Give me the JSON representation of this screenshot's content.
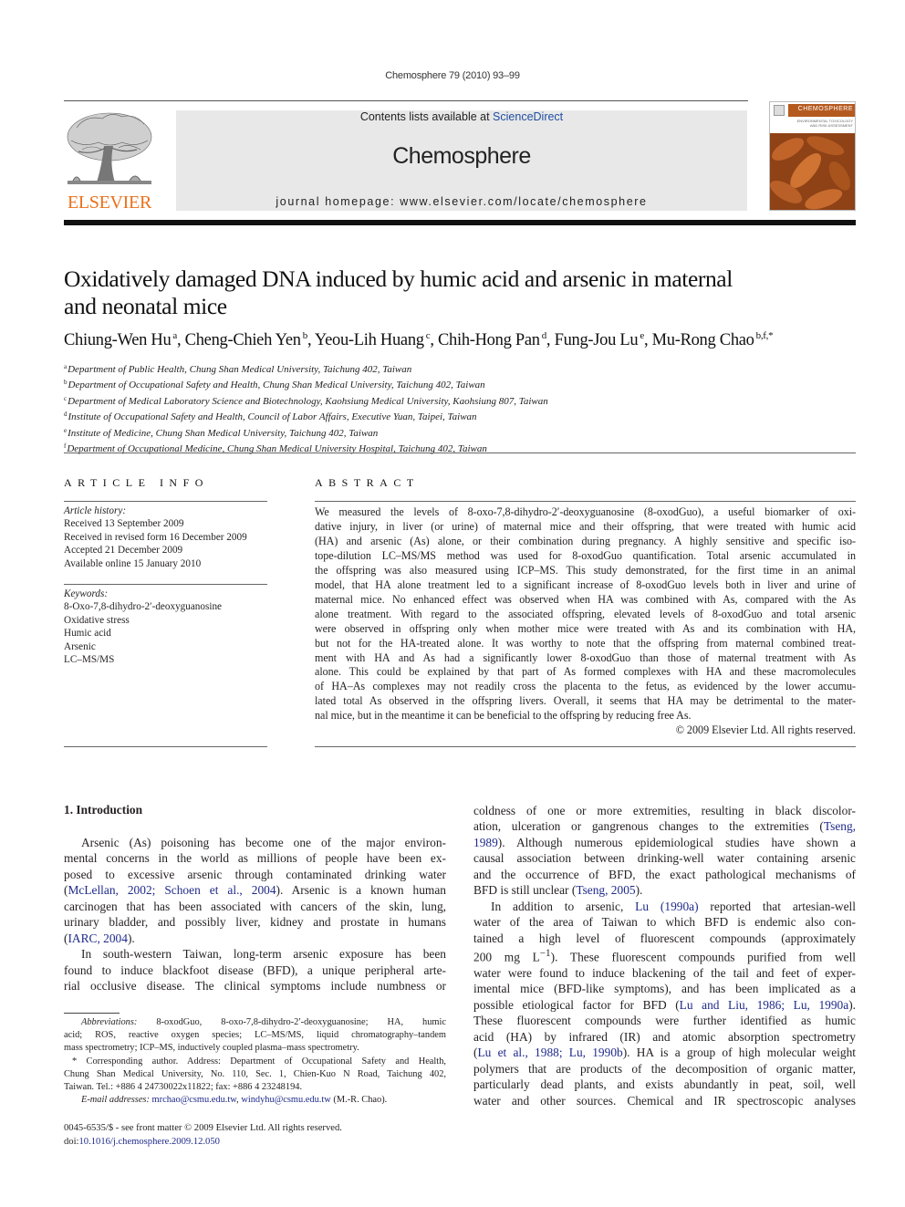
{
  "header": {
    "running_head": "Chemosphere 79 (2010) 93–99",
    "contents_prefix": "Contents lists available at ",
    "contents_link": "ScienceDirect",
    "journal_name": "Chemosphere",
    "homepage": "journal homepage: www.elsevier.com/locate/chemosphere",
    "publisher_logo_text": "ELSEVIER",
    "cover_title": "CHEMOSPHERE",
    "cover_subtitle": "ENVIRONMENTAL TOXICOLOGY AND RISK ASSESSMENT"
  },
  "colors": {
    "link": "#1f2a8a",
    "elsevier_orange": "#e9711c",
    "masthead_bg": "#e8e8e8",
    "cover_orange": "#a5501b"
  },
  "article": {
    "title_line1": "Oxidatively damaged DNA induced by humic acid and arsenic in maternal",
    "title_line2": "and neonatal mice",
    "authors": [
      {
        "name": "Chiung-Wen Hu",
        "sup": "a"
      },
      {
        "name": "Cheng-Chieh Yen",
        "sup": "b"
      },
      {
        "name": "Yeou-Lih Huang",
        "sup": "c"
      },
      {
        "name": "Chih-Hong Pan",
        "sup": "d"
      },
      {
        "name": "Fung-Jou Lu",
        "sup": "e"
      },
      {
        "name": "Mu-Rong Chao",
        "sup": "b,f,*"
      }
    ],
    "affiliations": [
      {
        "sup": "a",
        "text": "Department of Public Health, Chung Shan Medical University, Taichung 402, Taiwan"
      },
      {
        "sup": "b",
        "text": "Department of Occupational Safety and Health, Chung Shan Medical University, Taichung 402, Taiwan"
      },
      {
        "sup": "c",
        "text": "Department of Medical Laboratory Science and Biotechnology, Kaohsiung Medical University, Kaohsiung 807, Taiwan"
      },
      {
        "sup": "d",
        "text": "Institute of Occupational Safety and Health, Council of Labor Affairs, Executive Yuan, Taipei, Taiwan"
      },
      {
        "sup": "e",
        "text": "Institute of Medicine, Chung Shan Medical University, Taichung 402, Taiwan"
      },
      {
        "sup": "f",
        "text": "Department of Occupational Medicine, Chung Shan Medical University Hospital, Taichung 402, Taiwan"
      }
    ]
  },
  "article_info": {
    "heading": "ARTICLE INFO",
    "history_label": "Article history:",
    "history": [
      "Received 13 September 2009",
      "Received in revised form 16 December 2009",
      "Accepted 21 December 2009",
      "Available online 15 January 2010"
    ],
    "keywords_label": "Keywords:",
    "keywords": [
      "8-Oxo-7,8-dihydro-2′-deoxyguanosine",
      "Oxidative stress",
      "Humic acid",
      "Arsenic",
      "LC–MS/MS"
    ]
  },
  "abstract": {
    "heading": "ABSTRACT",
    "lines": [
      "We measured the levels of 8-oxo-7,8-dihydro-2′-deoxyguanosine (8-oxodGuo), a useful biomarker of oxi-",
      "dative injury, in liver (or urine) of maternal mice and their offspring, that were treated with humic acid",
      "(HA) and arsenic (As) alone, or their combination during pregnancy. A highly sensitive and specific iso-",
      "tope-dilution LC–MS/MS method was used for 8-oxodGuo quantification. Total arsenic accumulated in",
      "the offspring was also measured using ICP–MS. This study demonstrated, for the first time in an animal",
      "model, that HA alone treatment led to a significant increase of 8-oxodGuo levels both in liver and urine of",
      "maternal mice. No enhanced effect was observed when HA was combined with As, compared with the As",
      "alone treatment. With regard to the associated offspring, elevated levels of 8-oxodGuo and total arsenic",
      "were observed in offspring only when mother mice were treated with As and its combination with HA,",
      "but not for the HA-treated alone. It was worthy to note that the offspring from maternal combined treat-",
      "ment with HA and As had a significantly lower 8-oxodGuo than those of maternal treatment with As",
      "alone. This could be explained by that part of As formed complexes with HA and these macromolecules",
      "of HA–As complexes may not readily cross the placenta to the fetus, as evidenced by the lower accumu-",
      "lated total As observed in the offspring livers. Overall, it seems that HA may be detrimental to the mater-",
      "nal mice, but in the meantime it can be beneficial to the offspring by reducing free As."
    ],
    "copyright": "© 2009 Elsevier Ltd. All rights reserved."
  },
  "introduction": {
    "heading": "1. Introduction",
    "left_lines": [
      {
        "indent": true,
        "parts": [
          {
            "t": "Arsenic (As) poisoning has become one of the major environ-"
          }
        ]
      },
      {
        "parts": [
          {
            "t": "mental concerns in the world as millions of people have been ex-"
          }
        ]
      },
      {
        "parts": [
          {
            "t": "posed to excessive arsenic through contaminated drinking water"
          }
        ]
      },
      {
        "parts": [
          {
            "t": "("
          },
          {
            "t": "McLellan, 2002; Schoen et al., 2004",
            "link": true
          },
          {
            "t": "). Arsenic is a known human"
          }
        ]
      },
      {
        "parts": [
          {
            "t": "carcinogen that has been associated with cancers of the skin, lung,"
          }
        ]
      },
      {
        "parts": [
          {
            "t": "urinary bladder, and possibly liver, kidney and prostate in humans"
          }
        ]
      },
      {
        "last": true,
        "parts": [
          {
            "t": "("
          },
          {
            "t": "IARC, 2004",
            "link": true
          },
          {
            "t": ")."
          }
        ]
      },
      {
        "indent": true,
        "parts": [
          {
            "t": "In south-western Taiwan, long-term arsenic exposure has been"
          }
        ]
      },
      {
        "parts": [
          {
            "t": "found to induce blackfoot disease (BFD), a unique peripheral arte-"
          }
        ]
      },
      {
        "parts": [
          {
            "t": "rial occlusive disease. The clinical symptoms include numbness or"
          }
        ]
      }
    ],
    "right_lines": [
      {
        "parts": [
          {
            "t": "coldness of one or more extremities, resulting in black discolor-"
          }
        ]
      },
      {
        "parts": [
          {
            "t": "ation, ulceration or gangrenous changes to the extremities ("
          },
          {
            "t": "Tseng,",
            "link": true
          }
        ]
      },
      {
        "parts": [
          {
            "t": "1989",
            "link": true
          },
          {
            "t": "). Although numerous epidemiological studies have shown a"
          }
        ]
      },
      {
        "parts": [
          {
            "t": "causal association between drinking-well water containing arsenic"
          }
        ]
      },
      {
        "parts": [
          {
            "t": "and the occurrence of BFD, the exact pathological mechanisms of"
          }
        ]
      },
      {
        "last": true,
        "parts": [
          {
            "t": "BFD is still unclear ("
          },
          {
            "t": "Tseng, 2005",
            "link": true
          },
          {
            "t": ")."
          }
        ]
      },
      {
        "indent": true,
        "parts": [
          {
            "t": "In addition to arsenic, "
          },
          {
            "t": "Lu (1990a)",
            "link": true
          },
          {
            "t": " reported that artesian-well"
          }
        ]
      },
      {
        "parts": [
          {
            "t": "water of the area of Taiwan to which BFD is endemic also con-"
          }
        ]
      },
      {
        "parts": [
          {
            "t": "tained a high level of fluorescent compounds (approximately"
          }
        ]
      },
      {
        "parts": [
          {
            "t": "200 mg L"
          },
          {
            "t": "−1",
            "sup": true
          },
          {
            "t": "). These fluorescent compounds purified from well"
          }
        ]
      },
      {
        "parts": [
          {
            "t": "water were found to induce blackening of the tail and feet of exper-"
          }
        ]
      },
      {
        "parts": [
          {
            "t": "imental mice (BFD-like symptoms), and has been implicated as a"
          }
        ]
      },
      {
        "parts": [
          {
            "t": "possible etiological factor for BFD ("
          },
          {
            "t": "Lu and Liu, 1986; Lu, 1990a",
            "link": true
          },
          {
            "t": ")."
          }
        ]
      },
      {
        "parts": [
          {
            "t": "These fluorescent compounds were further identified as humic"
          }
        ]
      },
      {
        "parts": [
          {
            "t": "acid (HA) by infrared (IR) and atomic absorption spectrometry"
          }
        ]
      },
      {
        "parts": [
          {
            "t": "("
          },
          {
            "t": "Lu et al., 1988; Lu, 1990b",
            "link": true
          },
          {
            "t": "). HA is a group of high molecular weight"
          }
        ]
      },
      {
        "parts": [
          {
            "t": "polymers that are products of the decomposition of organic matter,"
          }
        ]
      },
      {
        "parts": [
          {
            "t": "particularly dead plants, and exists abundantly in peat, soil, well"
          }
        ]
      },
      {
        "parts": [
          {
            "t": "water and other sources. Chemical and IR spectroscopic analyses"
          }
        ]
      }
    ]
  },
  "footnotes": {
    "lines": [
      {
        "indent": true,
        "parts": [
          {
            "t": "Abbreviations:",
            "em": true
          },
          {
            "t": " 8-oxodGuo, 8-oxo-7,8-dihydro-2′-deoxyguanosine; HA, humic"
          }
        ]
      },
      {
        "parts": [
          {
            "t": "acid; ROS, reactive oxygen species; LC–MS/MS, liquid chromatography–tandem"
          }
        ]
      },
      {
        "last": true,
        "parts": [
          {
            "t": "mass spectrometry; ICP–MS, inductively coupled plasma–mass spectrometry."
          }
        ]
      },
      {
        "star": true,
        "parts": [
          {
            "t": "* Corresponding author. Address: Department of Occupational Safety and Health,"
          }
        ]
      },
      {
        "parts": [
          {
            "t": "Chung Shan Medical University, No. 110, Sec. 1, Chien-Kuo N Road, Taichung 402,"
          }
        ]
      },
      {
        "last": true,
        "parts": [
          {
            "t": "Taiwan. Tel.: +886 4 24730022x11822; fax: +886 4 23248194."
          }
        ]
      },
      {
        "indent": true,
        "last": true,
        "parts": [
          {
            "t": "E-mail addresses:",
            "em": true
          },
          {
            "t": " "
          },
          {
            "t": "mrchao@csmu.edu.tw",
            "link": true
          },
          {
            "t": ", "
          },
          {
            "t": "windyhu@csmu.edu.tw",
            "link": true
          },
          {
            "t": " (M.-R. Chao)."
          }
        ]
      }
    ]
  },
  "front_matter": {
    "issn_line": "0045-6535/$ - see front matter © 2009 Elsevier Ltd. All rights reserved.",
    "doi_prefix": "doi:",
    "doi": "10.1016/j.chemosphere.2009.12.050"
  }
}
